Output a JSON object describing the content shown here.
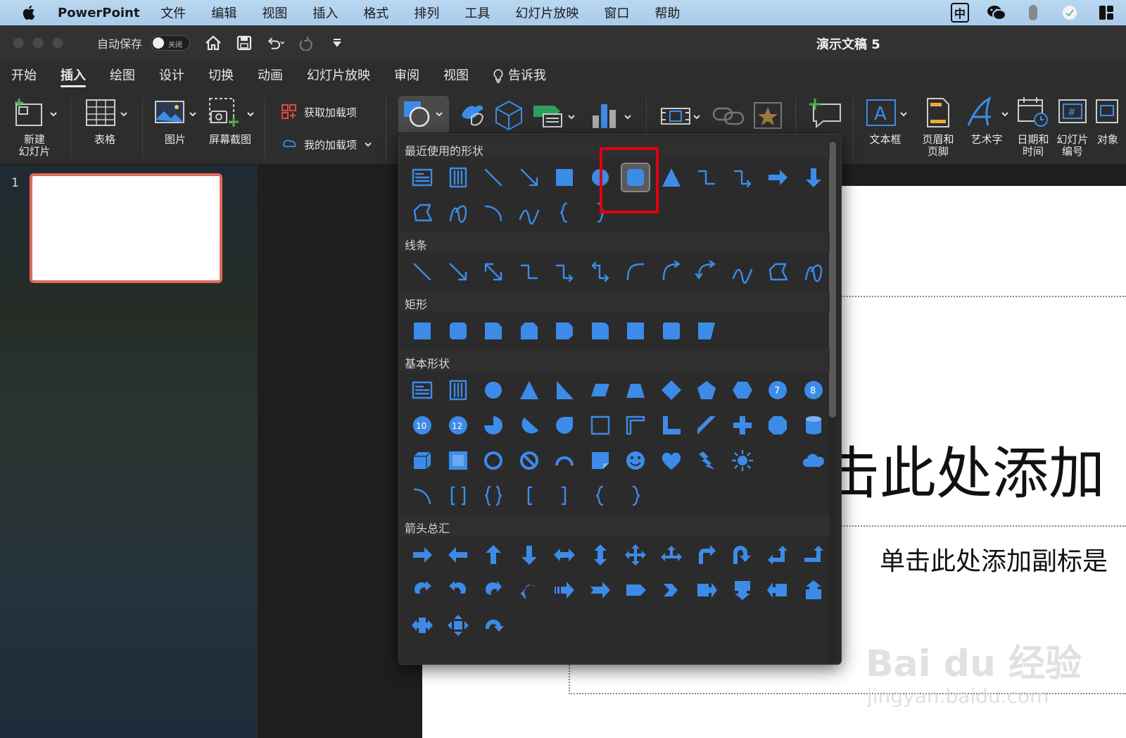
{
  "menubar": {
    "app_name": "PowerPoint",
    "items": [
      "文件",
      "编辑",
      "视图",
      "插入",
      "格式",
      "排列",
      "工具",
      "幻灯片放映",
      "窗口",
      "帮助"
    ],
    "right_icons": [
      "input-method-icon",
      "wechat-icon",
      "mouse-icon",
      "app-status-icon",
      "control-center-icon"
    ],
    "input_method": "中"
  },
  "titlebar": {
    "autosave_label": "自动保存",
    "toggle_label": "关闭",
    "document_title": "演示文稿 5"
  },
  "tabs": [
    "开始",
    "插入",
    "绘图",
    "设计",
    "切换",
    "动画",
    "幻灯片放映",
    "审阅",
    "视图"
  ],
  "active_tab": "插入",
  "tell_me": "告诉我",
  "ribbon": {
    "new_slide": "新建\n幻灯片",
    "table": "表格",
    "pictures": "图片",
    "screenshot": "屏幕截图",
    "get_addins": "获取加载项",
    "my_addins": "我的加载项",
    "textbox": "文本框",
    "header_footer": "页眉和\n页脚",
    "wordart": "艺术字",
    "date_time": "日期和\n时间",
    "slide_number": "幻灯片\n编号",
    "object": "对象"
  },
  "slides_pane": {
    "slide_number": "1"
  },
  "slide": {
    "title_placeholder": "击此处添加",
    "subtitle_placeholder": "单击此处添加副标是"
  },
  "watermark": {
    "line1": "Bai du 经验",
    "line2": "jingyan.baidu.com"
  },
  "shapes_panel": {
    "sections": [
      {
        "title": "最近使用的形状"
      },
      {
        "title": "线条"
      },
      {
        "title": "矩形"
      },
      {
        "title": "基本形状"
      },
      {
        "title": "箭头总汇"
      }
    ],
    "selected_shape": "rounded-rectangle"
  },
  "colors": {
    "accent": "#3d8be8",
    "highlight": "#e00010",
    "thumb_border": "#e06a5a"
  }
}
